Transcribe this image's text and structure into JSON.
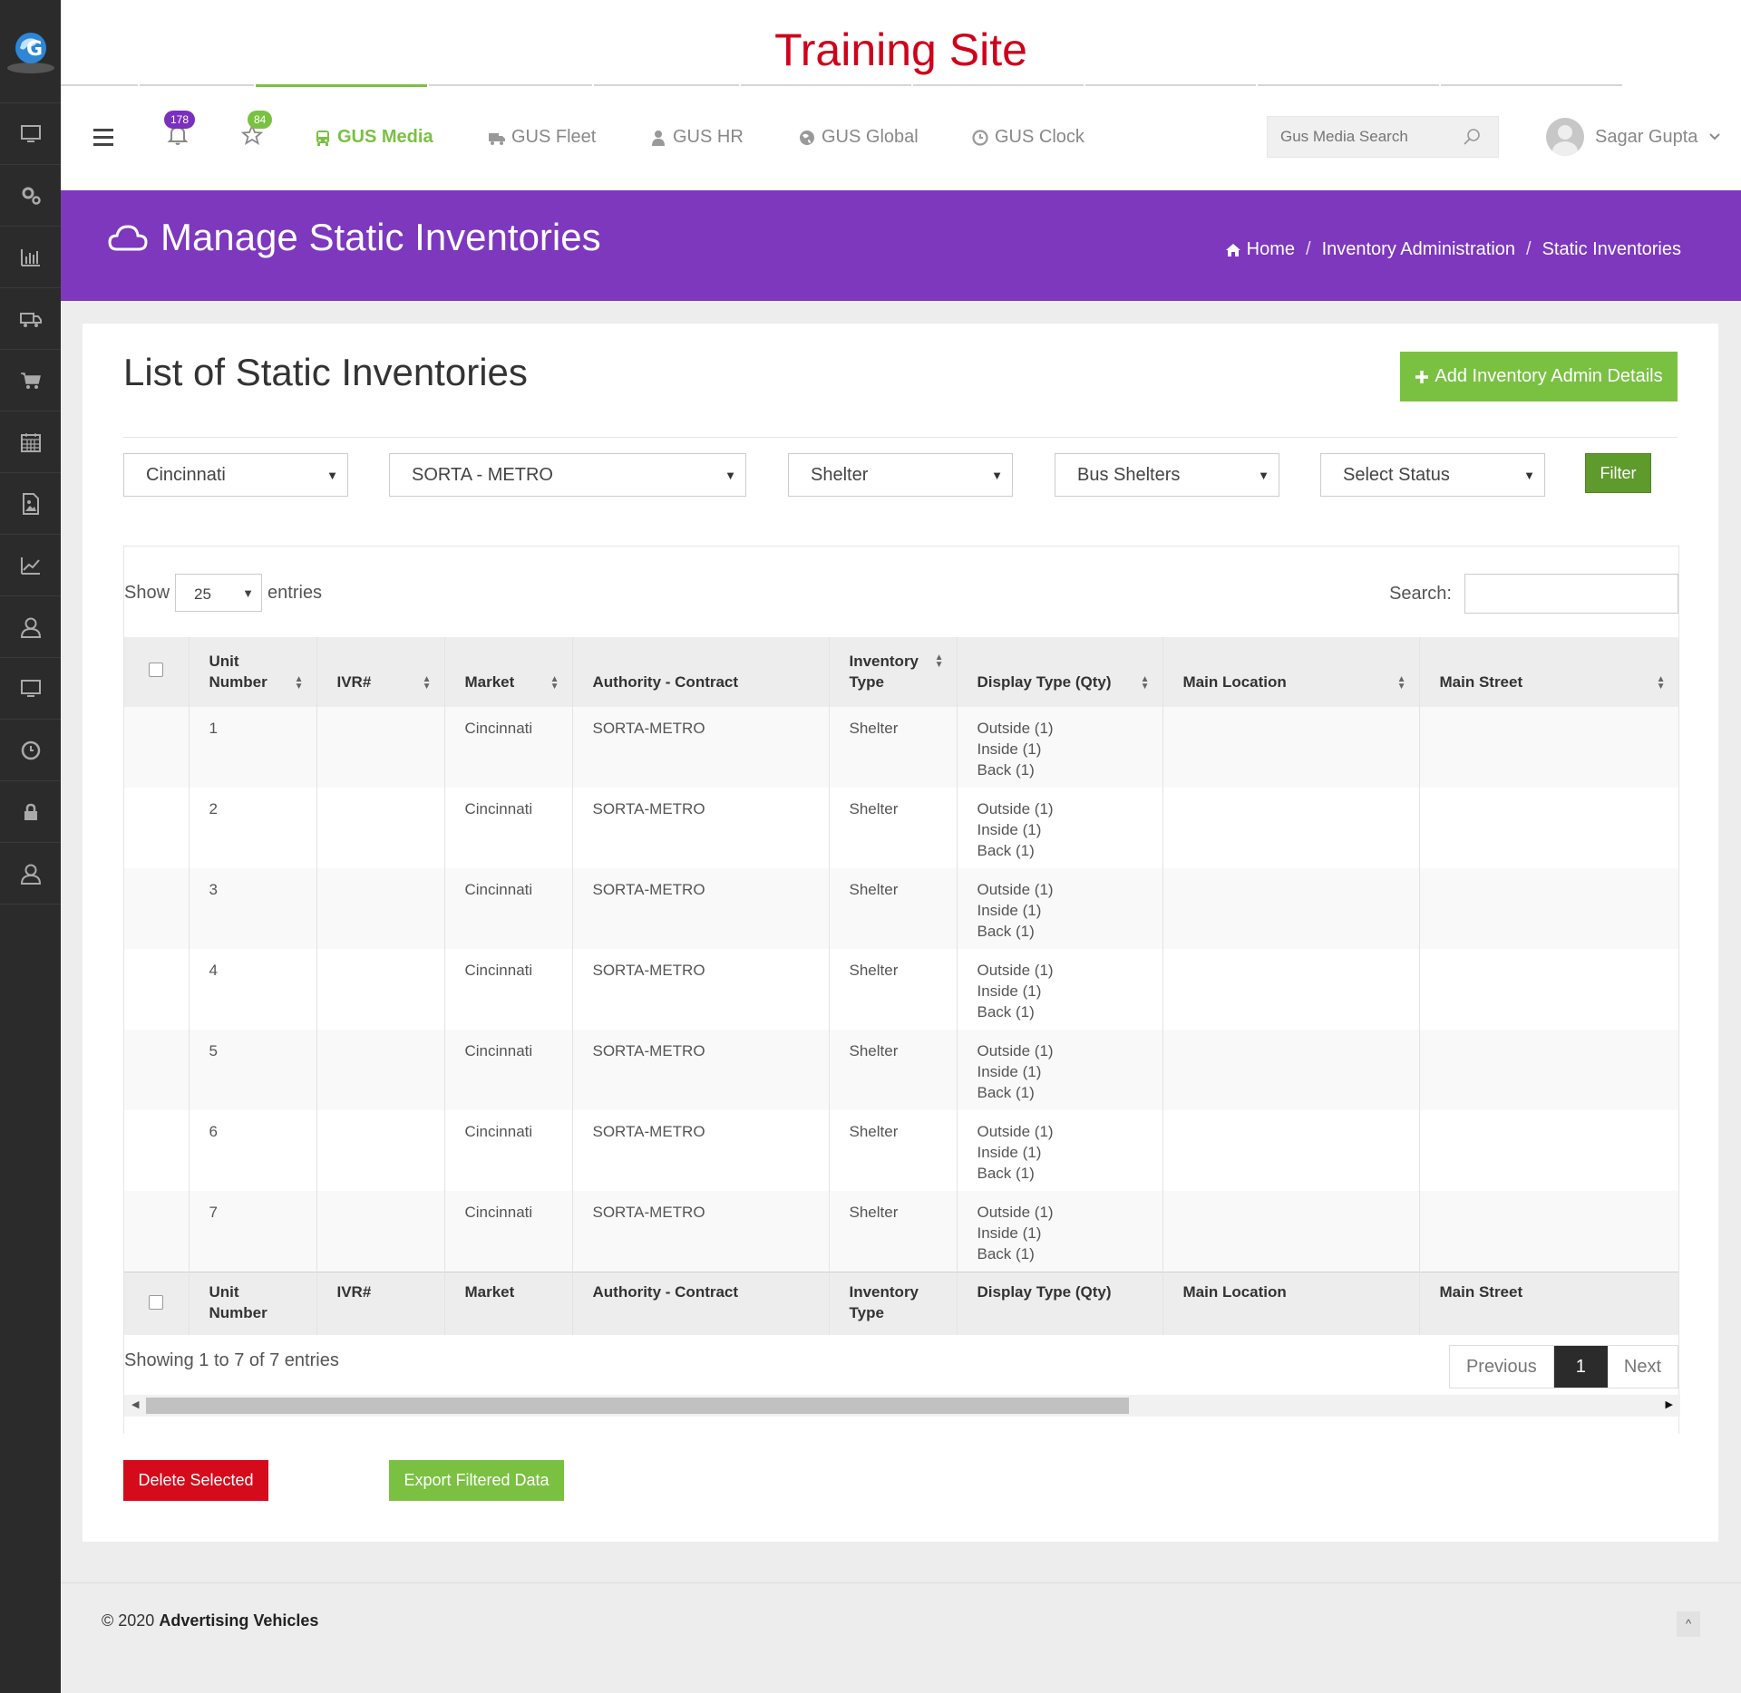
{
  "site_title": "Training Site",
  "nav": {
    "notifications_count": "178",
    "favorites_count": "84",
    "tabs": [
      {
        "label": "GUS Media",
        "icon": "bus-icon",
        "active": true
      },
      {
        "label": "GUS Fleet",
        "icon": "truck-icon",
        "active": false
      },
      {
        "label": "GUS HR",
        "icon": "person-icon",
        "active": false
      },
      {
        "label": "GUS Global",
        "icon": "globe-icon",
        "active": false
      },
      {
        "label": "GUS Clock",
        "icon": "clock-icon",
        "active": false
      }
    ],
    "search_placeholder": "Gus Media Search",
    "user_name": "Sagar Gupta"
  },
  "banner": {
    "title": "Manage Static Inventories",
    "breadcrumb": [
      "Home",
      "Inventory Administration",
      "Static Inventories"
    ]
  },
  "card": {
    "title": "List of Static Inventories",
    "add_button": "Add Inventory Admin Details",
    "filters": {
      "market": "Cincinnati",
      "contract": "SORTA - METRO",
      "inventory_type": "Shelter",
      "display": "Bus Shelters",
      "status": "Select Status",
      "button": "Filter"
    }
  },
  "table": {
    "show_label": "Show",
    "page_length": "25",
    "entries_label": "entries",
    "search_label": "Search:",
    "columns": [
      "Unit Number",
      "IVR#",
      "Market",
      "Authority - Contract",
      "Inventory Type",
      "Display Type (Qty)",
      "Main Location",
      "Main Street"
    ],
    "rows": [
      {
        "unit": "1",
        "ivr": "",
        "market": "Cincinnati",
        "contract": "SORTA-METRO",
        "type": "Shelter",
        "display": [
          "Outside (1)",
          "Inside (1)",
          "Back (1)"
        ],
        "location": "",
        "street": ""
      },
      {
        "unit": "2",
        "ivr": "",
        "market": "Cincinnati",
        "contract": "SORTA-METRO",
        "type": "Shelter",
        "display": [
          "Outside (1)",
          "Inside (1)",
          "Back (1)"
        ],
        "location": "",
        "street": ""
      },
      {
        "unit": "3",
        "ivr": "",
        "market": "Cincinnati",
        "contract": "SORTA-METRO",
        "type": "Shelter",
        "display": [
          "Outside (1)",
          "Inside (1)",
          "Back (1)"
        ],
        "location": "",
        "street": ""
      },
      {
        "unit": "4",
        "ivr": "",
        "market": "Cincinnati",
        "contract": "SORTA-METRO",
        "type": "Shelter",
        "display": [
          "Outside (1)",
          "Inside (1)",
          "Back (1)"
        ],
        "location": "",
        "street": ""
      },
      {
        "unit": "5",
        "ivr": "",
        "market": "Cincinnati",
        "contract": "SORTA-METRO",
        "type": "Shelter",
        "display": [
          "Outside (1)",
          "Inside (1)",
          "Back (1)"
        ],
        "location": "",
        "street": ""
      },
      {
        "unit": "6",
        "ivr": "",
        "market": "Cincinnati",
        "contract": "SORTA-METRO",
        "type": "Shelter",
        "display": [
          "Outside (1)",
          "Inside (1)",
          "Back (1)"
        ],
        "location": "",
        "street": ""
      },
      {
        "unit": "7",
        "ivr": "",
        "market": "Cincinnati",
        "contract": "SORTA-METRO",
        "type": "Shelter",
        "display": [
          "Outside (1)",
          "Inside (1)",
          "Back (1)"
        ],
        "location": "",
        "street": ""
      }
    ],
    "info": "Showing 1 to 7 of 7 entries",
    "pager": {
      "previous": "Previous",
      "current": "1",
      "next": "Next"
    },
    "scroll_fraction": 0.65
  },
  "actions": {
    "delete": "Delete Selected",
    "export": "Export Filtered Data"
  },
  "footer": {
    "copyright": "© 2020",
    "company": "Advertising Vehicles"
  },
  "colors": {
    "accent_green": "#7ac142",
    "banner_purple": "#7d38be",
    "title_red": "#d0021b",
    "delete_red": "#d50b1b"
  }
}
